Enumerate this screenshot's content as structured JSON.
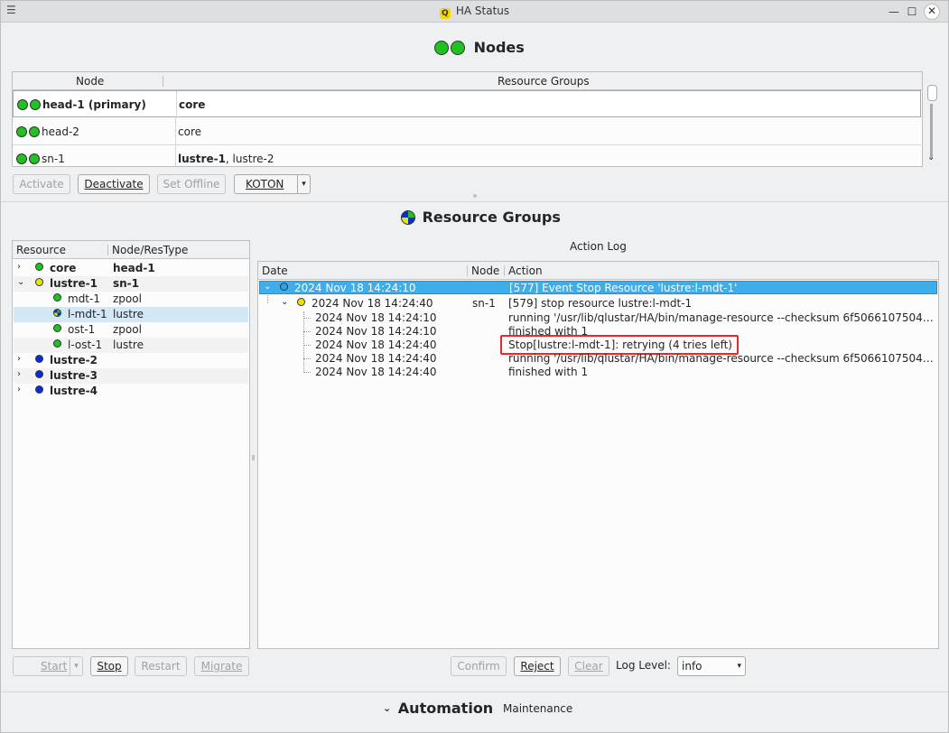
{
  "window": {
    "title": "HA Status"
  },
  "nodes_section": {
    "title": "Nodes",
    "columns": [
      "Node",
      "Resource Groups"
    ],
    "rows": [
      {
        "node": "head-1 (primary)",
        "groups_bold": "core",
        "groups_rest": "",
        "bold": true
      },
      {
        "node": "head-2",
        "groups_bold": "",
        "groups_rest": "core",
        "bold": false
      },
      {
        "node": "sn-1",
        "groups_bold": "lustre-1",
        "groups_rest": ", lustre-2",
        "bold": false
      }
    ],
    "buttons": {
      "activate": "Activate",
      "deactivate": "Deactivate",
      "set_offline": "Set Offline",
      "koton": "KOTON"
    }
  },
  "resource_groups_section": {
    "title": "Resource Groups",
    "tree_columns": [
      "Resource",
      "Node/ResType"
    ],
    "tree": [
      {
        "name": "core",
        "type": "head-1"
      },
      {
        "name": "lustre-1",
        "type": "sn-1"
      },
      {
        "name": "mdt-1",
        "type": "zpool"
      },
      {
        "name": "l-mdt-1",
        "type": "lustre"
      },
      {
        "name": "ost-1",
        "type": "zpool"
      },
      {
        "name": "l-ost-1",
        "type": "lustre"
      },
      {
        "name": "lustre-2",
        "type": ""
      },
      {
        "name": "lustre-3",
        "type": ""
      },
      {
        "name": "lustre-4",
        "type": ""
      }
    ],
    "buttons": {
      "start": "Start",
      "stop": "Stop",
      "restart": "Restart",
      "migrate": "Migrate"
    }
  },
  "action_log": {
    "title": "Action Log",
    "columns": [
      "Date",
      "Node",
      "Action"
    ],
    "rows": [
      {
        "date": "2024 Nov 18 14:24:10",
        "node": "",
        "action": "[577] Event Stop Resource 'lustre:l-mdt-1'"
      },
      {
        "date": "2024 Nov 18 14:24:40",
        "node": "sn-1",
        "action": "[579] stop resource lustre:l-mdt-1"
      },
      {
        "date": "2024 Nov 18 14:24:10",
        "node": "",
        "action": "running '/usr/lib/qlustar/HA/bin/manage-resource --checksum 6f5066107504…"
      },
      {
        "date": "2024 Nov 18 14:24:10",
        "node": "",
        "action": "finished with 1"
      },
      {
        "date": "2024 Nov 18 14:24:40",
        "node": "",
        "action": "Stop[lustre:l-mdt-1]: retrying (4 tries left)"
      },
      {
        "date": "2024 Nov 18 14:24:40",
        "node": "",
        "action": "running '/usr/lib/qlustar/HA/bin/manage-resource --checksum 6f5066107504…"
      },
      {
        "date": "2024 Nov 18 14:24:40",
        "node": "",
        "action": "finished with 1"
      }
    ],
    "buttons": {
      "confirm": "Confirm",
      "reject": "Reject",
      "clear": "Clear"
    },
    "log_level_label": "Log Level:",
    "log_level_value": "info"
  },
  "footer": {
    "automation": "Automation",
    "maintenance": "Maintenance"
  },
  "colors": {
    "accent": "#3daee9",
    "online": "#21c121",
    "pending": "#e6e600",
    "offline": "#0a2cd8",
    "highlight": "#e8282a"
  }
}
